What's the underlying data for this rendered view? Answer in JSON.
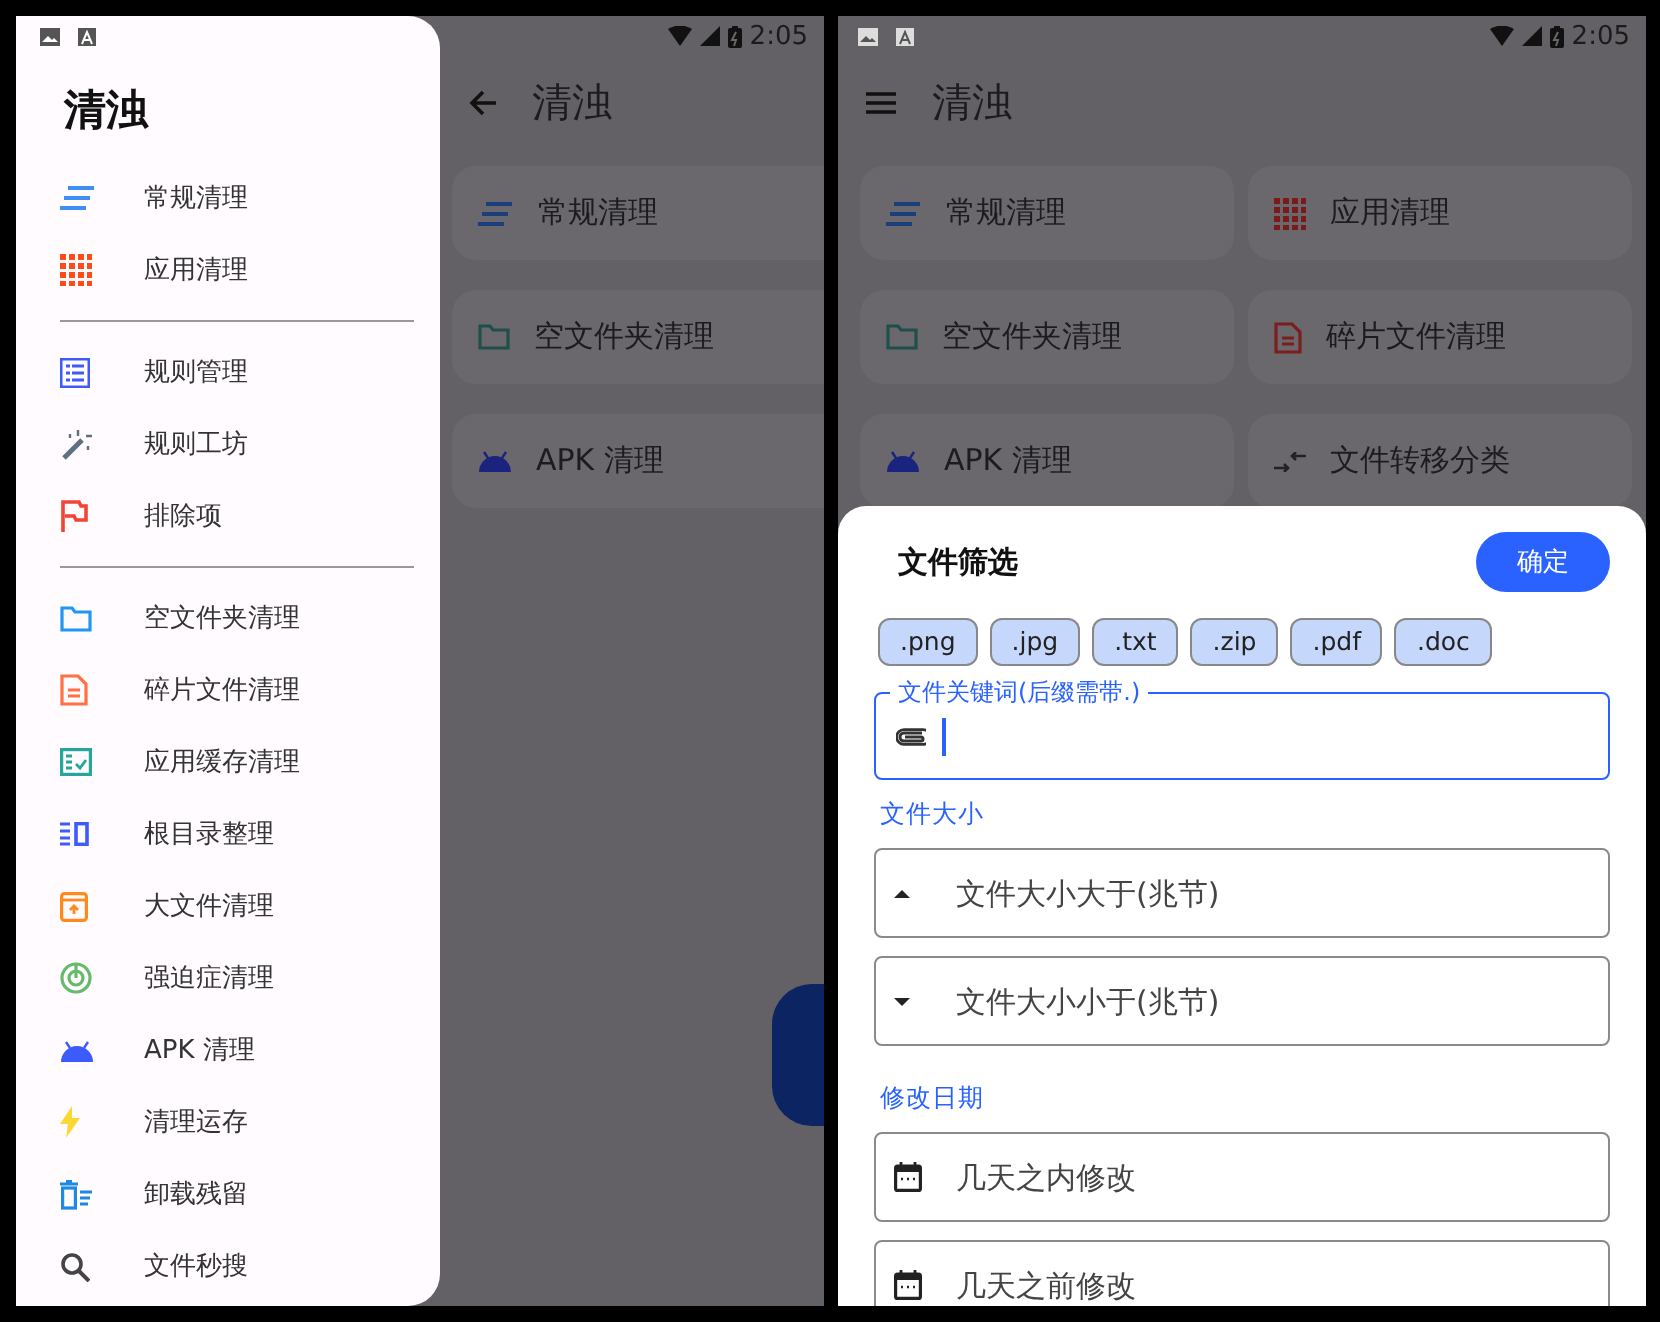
{
  "screens": [
    {
      "kind": "drawer",
      "status_bar": {
        "time": "2:05"
      },
      "app_bar": {
        "kind": "back",
        "title": "清浊"
      },
      "cards": [
        {
          "label": "常规清理"
        },
        {
          "label": "空文件夹清理"
        },
        {
          "label": "APK 清理"
        }
      ],
      "drawer": {
        "title": "清浊",
        "groups": [
          [
            {
              "label": "常规清理"
            },
            {
              "label": "应用清理"
            }
          ],
          [
            {
              "label": "规则管理"
            },
            {
              "label": "规则工坊"
            },
            {
              "label": "排除项"
            }
          ],
          [
            {
              "label": "空文件夹清理"
            },
            {
              "label": "碎片文件清理"
            },
            {
              "label": "应用缓存清理"
            },
            {
              "label": "根目录整理"
            },
            {
              "label": "大文件清理"
            },
            {
              "label": "强迫症清理"
            },
            {
              "label": "APK 清理"
            },
            {
              "label": "清理运存"
            },
            {
              "label": "卸载残留"
            },
            {
              "label": "文件秒搜"
            }
          ]
        ]
      }
    },
    {
      "kind": "sheet",
      "status_bar": {
        "time": "2:05"
      },
      "app_bar": {
        "kind": "menu",
        "title": "清浊"
      },
      "cards": [
        {
          "label": "常规清理"
        },
        {
          "label": "应用清理"
        },
        {
          "label": "空文件夹清理"
        },
        {
          "label": "碎片文件清理"
        },
        {
          "label": "APK 清理"
        },
        {
          "label": "文件转移分类"
        }
      ],
      "sheet": {
        "title": "文件筛选",
        "confirm": "确定",
        "chips": [
          ".png",
          ".jpg",
          ".txt",
          ".zip",
          ".pdf",
          ".doc"
        ],
        "keyword_field": {
          "label": "文件关键词(后缀需带.)",
          "focused": true
        },
        "sections": [
          {
            "heading": "文件大小",
            "fields": [
              {
                "placeholder": "文件大小大于(兆节)"
              },
              {
                "placeholder": "文件大小小于(兆节)"
              }
            ]
          },
          {
            "heading": "修改日期",
            "fields": [
              {
                "placeholder": "几天之内修改"
              },
              {
                "placeholder": "几天之前修改"
              }
            ]
          }
        ]
      }
    }
  ]
}
